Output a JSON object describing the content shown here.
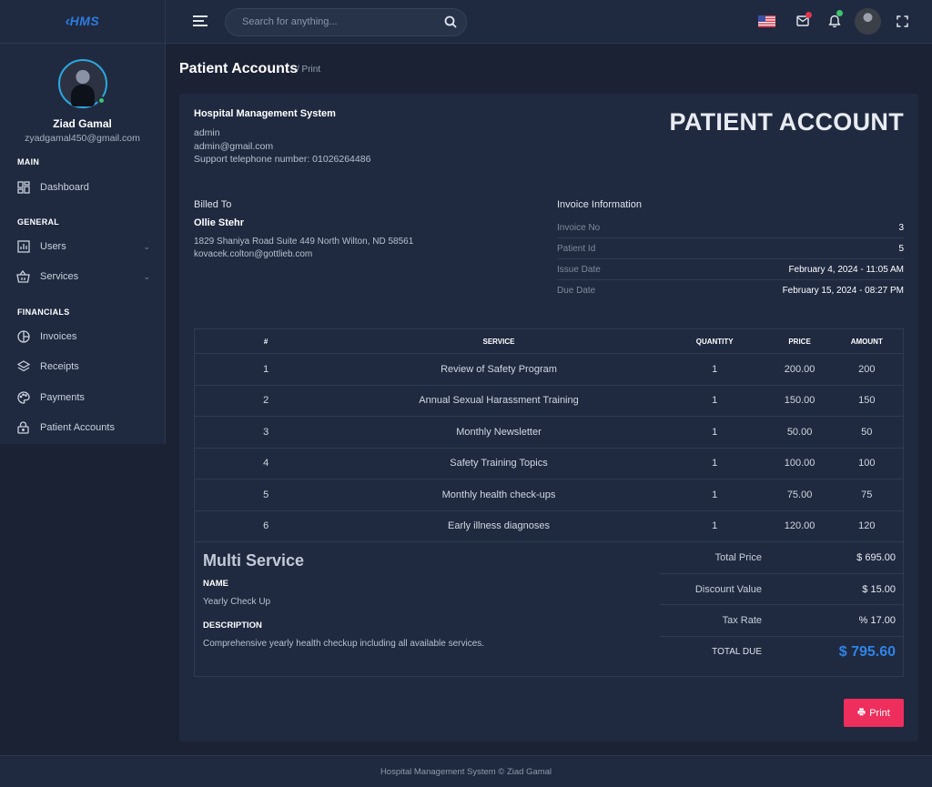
{
  "brand": {
    "logo": "HMS"
  },
  "user": {
    "name": "Ziad Gamal",
    "email": "zyadgamal450@gmail.com"
  },
  "sidebar": {
    "sections": [
      {
        "title": "MAIN"
      },
      {
        "title": "GENERAL"
      },
      {
        "title": "FINANCIALS"
      }
    ],
    "items": [
      {
        "label": "Dashboard",
        "icon": "dashboard-icon"
      },
      {
        "label": "Users",
        "icon": "chart-icon"
      },
      {
        "label": "Services",
        "icon": "basket-icon"
      },
      {
        "label": "Invoices",
        "icon": "pie-icon"
      },
      {
        "label": "Receipts",
        "icon": "layers-icon"
      },
      {
        "label": "Payments",
        "icon": "palette-icon"
      },
      {
        "label": "Patient Accounts",
        "icon": "lock-icon"
      }
    ]
  },
  "search": {
    "placeholder": "Search for anything..."
  },
  "page": {
    "title": "Patient Accounts",
    "crumb": "/ Print"
  },
  "hospital": {
    "name": "Hospital Management System",
    "user": "admin",
    "email": "admin@gmail.com",
    "support": "Support telephone number: 01026264486"
  },
  "doc_title": "PATIENT ACCOUNT",
  "billed": {
    "label": "Billed To",
    "name": "Ollie Stehr",
    "address": "1829 Shaniya Road Suite 449 North Wilton, ND 58561",
    "email": "kovacek.colton@gottlieb.com"
  },
  "invoice": {
    "label": "Invoice Information",
    "rows": [
      {
        "k": "Invoice No",
        "v": "3"
      },
      {
        "k": "Patient Id",
        "v": "5"
      },
      {
        "k": "Issue Date",
        "v": "February 4, 2024 - 11:05 AM"
      },
      {
        "k": "Due Date",
        "v": "February 15, 2024 - 08:27 PM"
      }
    ]
  },
  "table": {
    "headers": [
      "#",
      "SERVICE",
      "QUANTITY",
      "PRICE",
      "AMOUNT"
    ],
    "rows": [
      [
        "1",
        "Review of Safety Program",
        "1",
        "200.00",
        "200"
      ],
      [
        "2",
        "Annual Sexual Harassment Training",
        "1",
        "150.00",
        "150"
      ],
      [
        "3",
        "Monthly Newsletter",
        "1",
        "50.00",
        "50"
      ],
      [
        "4",
        "Safety Training Topics",
        "1",
        "100.00",
        "100"
      ],
      [
        "5",
        "Monthly health check-ups",
        "1",
        "75.00",
        "75"
      ],
      [
        "6",
        "Early illness diagnoses",
        "1",
        "120.00",
        "120"
      ]
    ]
  },
  "summary": {
    "title": "Multi Service",
    "name_label": "NAME",
    "name_value": "Yearly Check Up",
    "desc_label": "DESCRIPTION",
    "desc_value": "Comprehensive yearly health checkup including all available services."
  },
  "totals": [
    {
      "k": "Total Price",
      "v": "$ 695.00"
    },
    {
      "k": "Discount Value",
      "v": "$ 15.00"
    },
    {
      "k": "Tax Rate",
      "v": "% 17.00"
    },
    {
      "k": "TOTAL DUE",
      "v": "$ 795.60"
    }
  ],
  "print_label": "Print",
  "footer": "Hospital Management System © Ziad Gamal",
  "colors": {
    "accent": "#2f84e6",
    "print": "#ee2e5c",
    "bg": "#1a2234",
    "panel": "#1f2a40"
  }
}
